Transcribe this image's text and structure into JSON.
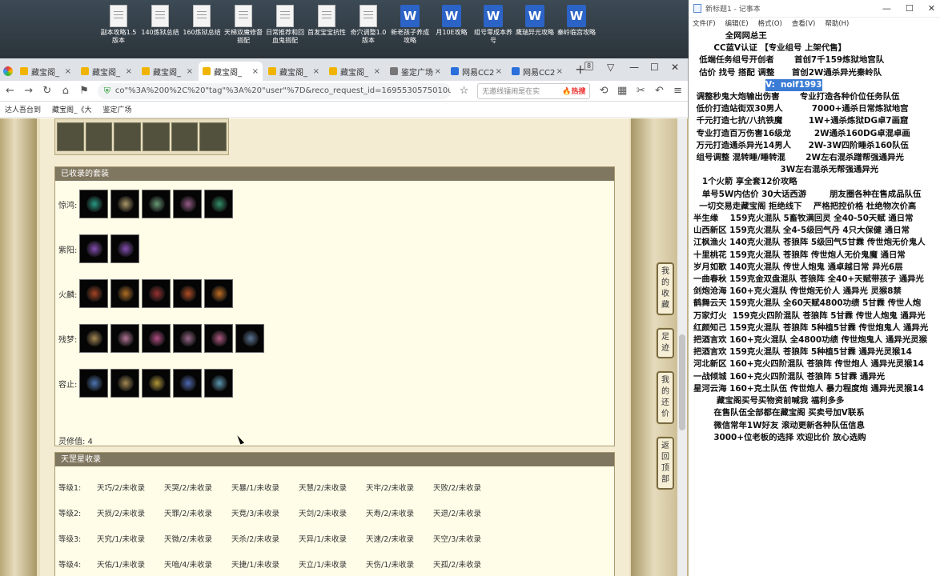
{
  "desktop": {
    "icons": [
      {
        "label": "副本攻略1.5版本",
        "kind": "doc"
      },
      {
        "label": "140炼狱总结",
        "kind": "doc"
      },
      {
        "label": "160炼狱总结",
        "kind": "doc"
      },
      {
        "label": "天梯双魔修督搭配",
        "kind": "doc"
      },
      {
        "label": "日常推荐和回血鬼搭配",
        "kind": "doc"
      },
      {
        "label": "首发宝宝抗性",
        "kind": "doc"
      },
      {
        "label": "奇穴调整1.0版本",
        "kind": "doc"
      },
      {
        "label": "新老孩子养成攻略",
        "kind": "word"
      },
      {
        "label": "月10E攻略",
        "kind": "word"
      },
      {
        "label": "组号零成本养号",
        "kind": "word"
      },
      {
        "label": "鹰瑞异光攻略",
        "kind": "word"
      },
      {
        "label": "秦岭临宫攻略",
        "kind": "word"
      }
    ]
  },
  "browser": {
    "tabs": [
      {
        "label": "藏宝阁_",
        "color": "#f0b400"
      },
      {
        "label": "藏宝阁_",
        "color": "#f0b400"
      },
      {
        "label": "藏宝阁_",
        "color": "#f0b400"
      },
      {
        "label": "藏宝阁_",
        "color": "#f0b400"
      },
      {
        "label": "藏宝阁_",
        "color": "#f0b400"
      },
      {
        "label": "藏宝阁_",
        "color": "#f0b400"
      },
      {
        "label": "鉴定广场",
        "color": "#777777"
      },
      {
        "label": "网易CC2",
        "color": "#2a6fdb"
      },
      {
        "label": "网易CC2",
        "color": "#2a6fdb"
      }
    ],
    "tab_close": "×",
    "new_tab": "+",
    "tab_count": "8",
    "win_min": "—",
    "win_max": "☐",
    "win_close": "✕",
    "nav": {
      "back": "←",
      "forward": "→",
      "refresh": "↻",
      "home": "⌂",
      "star": "☆"
    },
    "url": "co\"%3A%200%2C%20\"tag\"%3A%20\"user\"%7D&reco_request_id=1695530575010uk6l2",
    "secure_icon": "⛨",
    "search_placeholder": "无邀线镭闹是在实",
    "search_hot": "🔥热搜",
    "bookmarks": [
      "达人吾台到",
      "藏宝阁_《大",
      "鉴定广场"
    ]
  },
  "page": {
    "suits_panel": {
      "title": "已收录的套装",
      "rows": [
        {
          "label": "惊鸿:",
          "items": [
            "#2fb39a",
            "#c9b37a",
            "#7ab38a",
            "#b06aa0",
            "#3aa87a"
          ]
        },
        {
          "label": "紫阳:",
          "items": [
            "#9a5bd0",
            "#9a5bd0"
          ]
        },
        {
          "label": "火麟:",
          "items": [
            "#c0502a",
            "#d0802a",
            "#b03a3a",
            "#d05a2a",
            "#e0802a"
          ]
        },
        {
          "label": "残梦:",
          "items": [
            "#c0a060",
            "#d08ab0",
            "#d05a9a",
            "#b07aa0",
            "#d06a9a",
            "#6a8ab0"
          ]
        },
        {
          "label": "容止:",
          "items": [
            "#5a8ad0",
            "#c0a060",
            "#d0b040",
            "#5a7ad0",
            "#6ab0d0"
          ]
        }
      ],
      "footer": "灵修值:  4"
    },
    "tiangang_panel": {
      "title": "天罡星收录",
      "levels": [
        {
          "label": "等级1:",
          "cells": [
            "天巧/2/未收录",
            "天哭/2/未收录",
            "天暴/1/未收录",
            "天慧/2/未收录",
            "天牢/2/未收录",
            "天败/2/未收录"
          ]
        },
        {
          "label": "等级2:",
          "cells": [
            "天损/2/未收录",
            "天罪/2/未收录",
            "天竟/3/未收录",
            "天剑/2/未收录",
            "天寿/2/未收录",
            "天退/2/未收录"
          ]
        },
        {
          "label": "等级3:",
          "cells": [
            "天究/1/未收录",
            "天微/2/未收录",
            "天杀/2/未收录",
            "天异/1/未收录",
            "天速/2/未收录",
            "天空/3/未收录"
          ]
        },
        {
          "label": "等级4:",
          "cells": [
            "天佑/1/未收录",
            "天喑/4/未收录",
            "天捷/1/未收录",
            "天立/1/未收录",
            "天伤/1/未收录",
            "天孤/2/未收录"
          ]
        }
      ]
    },
    "side_buttons": [
      {
        "label": "我的收藏"
      },
      {
        "label": "足迹"
      },
      {
        "label": "我的还价"
      },
      {
        "label": "返回顶部"
      }
    ]
  },
  "notepad": {
    "title": "新标题1 - 记事本",
    "menu": [
      "文件(F)",
      "编辑(E)",
      "格式(O)",
      "查看(V)",
      "帮助(H)"
    ],
    "win_min": "—",
    "win_max": "☐",
    "win_close": "✕",
    "lines": [
      "           全网网总王",
      "       CC蓝V认证 【专业组号 上架代售】",
      "  低端任务组号开创者       首创7千159炼狱地宫队",
      "  估价 找号 搭配 调整      首创2W通杀异光秦岭队",
      "                V:  noif1993",
      "",
      " 调整秒鬼大炮输出伤害       专业打造各种价位任务队伍",
      " 低价打造站街双30男人          7000+通杀日常炼狱地宫",
      " 千元打造七抗/八抗铁魔         1W+通杀炼狱DG卓7画窟",
      " 专业打造百万伤害16级龙        2W通杀160DG卓混卓画",
      " 万元打造通杀异光14男人      2W-3W四阶睡杀160队伍",
      " 组号调整 混转睡/睡转混       2W左右混杀蹭帮强通异光",
      "                              3W左右混杀无帮强通异光",
      "   1个火箭 享全套12价攻略",
      "   单号5W内估价 30大话西游        朋友圈各种在售成品队伍",
      "  一切交易走藏宝阁 拒绝线下    严格把控价格 杜绝物次价高",
      "",
      "",
      "半生缘    159克火混队 5畜牧满回灵 全40-50天赋 通日常",
      "山西新区 159克火混队 全4-5级回气丹 4只大保健 通日常",
      "江枫渔火 140克火混队 苍狼阵 5级回气5甘霖 传世炮无价鬼人",
      "十里桃花 159克火混队 苍狼阵 传世炮人无价鬼魔 通日常",
      "岁月如歌 140克火混队 传世人炮鬼 通卓越日常 异光6层",
      "一曲春秋 159克金双盘混队 苍狼阵 全40+天赋带孩子 通异光",
      "剑炮沧海 160+克火混队 传世炮无价人 通异光 灵猴8禁",
      "鹤舞云天 159克火混队 全60天赋4800功绩 5甘霖 传世人炮",
      "万家灯火  159克火四阶混队 苍狼阵 5甘霖 传世人炮鬼 通异光",
      "红颜知己 159克火混队 苍狼阵 5种植5甘霖 传世炮鬼人 通异光",
      "把酒言欢 160+克火混队 全4800功绩 传世炮鬼人 通异光灵猴",
      "把酒言欢 159克火混队 苍狼阵 5种植5甘霖 通异光灵猴14",
      "河北新区 160+克火四阶混队 苍狼阵 传世炮人 通异光灵猴14",
      "一战倾城 160+克火四阶混队 苍狼阵 5甘霖 通异光",
      "星河云海 160+克土队伍 传世炮人 暴力程度炮 通异光灵猴14",
      "",
      "",
      "        藏宝阁买号买物资前喊我 福利多多",
      "       在售队伍全部都在藏宝阁 买卖号加V联系",
      "       微信常年1W好友 滚动更新各种队伍信息",
      "       3000+位老板的选择 欢迎比价 放心选购"
    ]
  },
  "colors": {
    "panel_header": "#807760",
    "page_bg": "#f3ecd3",
    "highlight": "#3a7bd5"
  }
}
